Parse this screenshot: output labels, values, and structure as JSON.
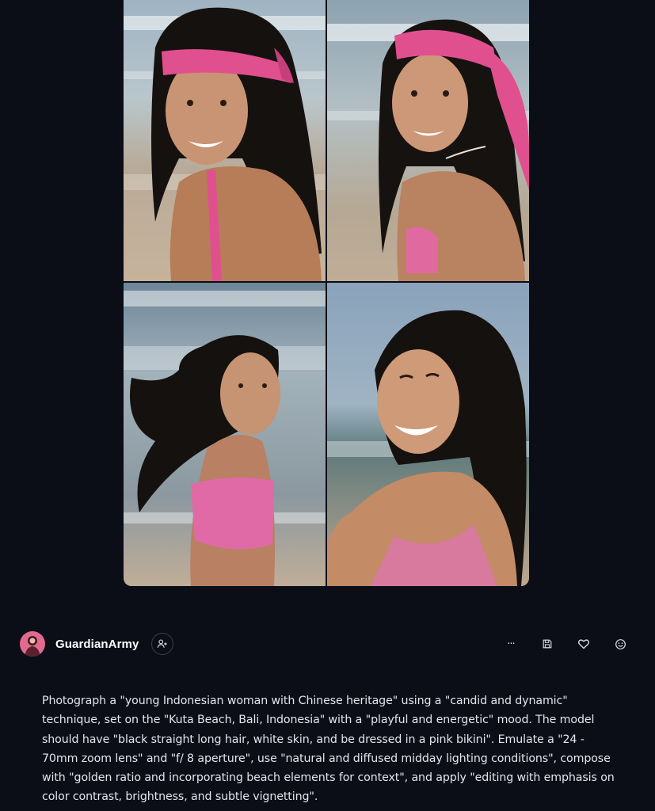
{
  "gallery": {
    "images": [
      {
        "icon": "photo-beach-woman-pink-headscarf-smiling"
      },
      {
        "icon": "photo-beach-woman-pink-headscarf-looking-side"
      },
      {
        "icon": "photo-beach-woman-windblown-hair-pink-top"
      },
      {
        "icon": "photo-beach-woman-laughing-pink-top"
      }
    ]
  },
  "author": {
    "username": "GuardianArmy",
    "avatar_icon": "avatar-pink-figure",
    "follow_icon": "person-plus-icon"
  },
  "actions": {
    "more_label": "···",
    "icons": [
      "more-icon",
      "save-icon",
      "heart-icon",
      "smile-icon"
    ]
  },
  "prompt": {
    "text": "Photograph a \"young Indonesian woman with Chinese heritage\" using a \"candid and dynamic\" technique, set on the \"Kuta Beach, Bali, Indonesia\" with a \"playful and energetic\" mood. The model should have \"black straight long hair, white skin, and be dressed in a pink bikini\". Emulate a \"24 - 70mm zoom lens\" and \"f/ 8 aperture\", use \"natural and diffused midday lighting conditions\", compose with \"golden ratio and incorporating beach elements for context\", and apply \"editing with emphasis on color contrast, brightness, and subtle vignetting\"."
  },
  "colors": {
    "background": "#0b0e17",
    "text": "#e4e6ec",
    "accent_pink": "#e0508f"
  }
}
